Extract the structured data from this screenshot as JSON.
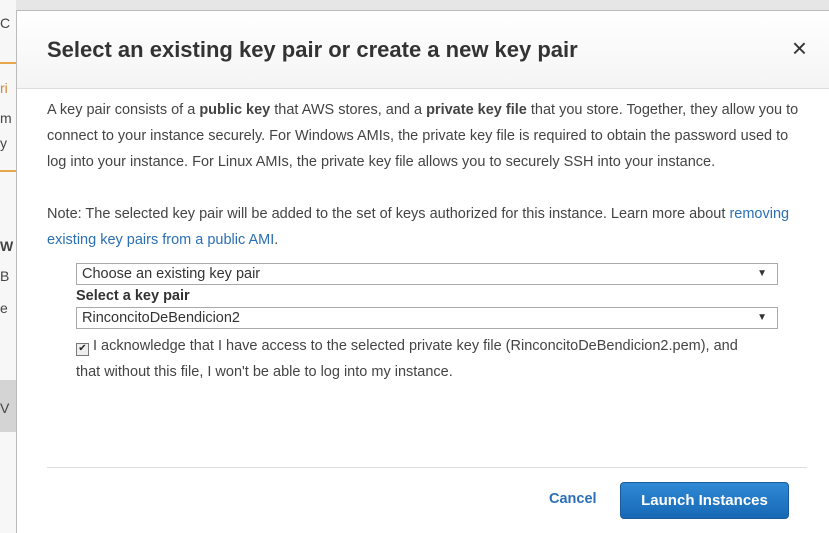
{
  "background": {
    "fragments": [
      "C",
      "ri",
      "m",
      "y",
      "W",
      "B",
      "e",
      "V"
    ]
  },
  "modal": {
    "title": "Select an existing key pair or create a new key pair",
    "close_icon": "×",
    "para1": {
      "t1": "A key pair consists of a ",
      "b1": "public key",
      "t2": " that AWS stores, and a ",
      "b2": "private key file",
      "t3": " that you store. Together, they allow you to connect to your instance securely. For Windows AMIs, the private key file is required to obtain the password used to log into your instance. For Linux AMIs, the private key file allows you to securely SSH into your instance."
    },
    "para2": {
      "text": "Note: The selected key pair will be added to the set of keys authorized for this instance. Learn more about ",
      "link": "removing existing key pairs from a public AMI",
      "end": "."
    },
    "mode_select": {
      "value": "Choose an existing key pair",
      "arrow": "▼"
    },
    "keypair_label": "Select a key pair",
    "keypair_select": {
      "value": "RinconcitoDeBendicion2",
      "arrow": "▼"
    },
    "acknowledge": {
      "checked_mark": "✔",
      "text": "I acknowledge that I have access to the selected private key file (RinconcitoDeBendicion2.pem), and that without this file, I won't be able to log into my instance."
    },
    "cancel_label": "Cancel",
    "launch_label": "Launch Instances"
  }
}
